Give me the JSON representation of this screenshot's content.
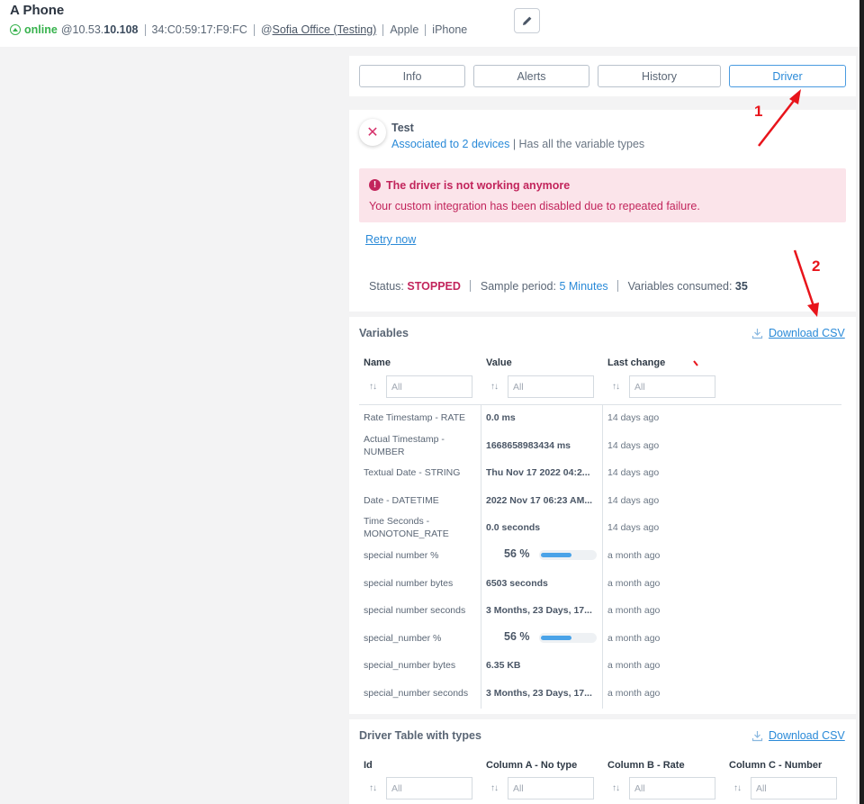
{
  "header": {
    "device_name": "A Phone",
    "status": "online",
    "ip_prefix": "@10.53.",
    "ip_suffix": "10.108",
    "mac": "34:C0:59:17:F9:FC",
    "location_prefix": "@",
    "location": "Sofia Office (Testing)",
    "manufacturer": "Apple",
    "model": "iPhone"
  },
  "tabs": [
    "Info",
    "Alerts",
    "History",
    "Driver"
  ],
  "driver": {
    "name": "Test",
    "associated_link": "Associated to 2 devices",
    "description": "| Has all the variable types",
    "alert_title": "The driver is not working anymore",
    "alert_message": "Your custom integration has been disabled due to repeated failure.",
    "retry_label": "Retry now",
    "status_label": "Status:",
    "status_value": "STOPPED",
    "sample_label": "Sample period:",
    "sample_value": "5 Minutes",
    "consumed_label": "Variables consumed:",
    "consumed_value": "35"
  },
  "variables": {
    "title": "Variables",
    "download_label": "Download CSV",
    "columns": [
      "Name",
      "Value",
      "Last change"
    ],
    "filter_placeholder": "All",
    "rows": [
      {
        "name": "Rate Timestamp - RATE",
        "value": "0.0 ms",
        "last": "14 days ago"
      },
      {
        "name": "Actual Timestamp - NUMBER",
        "value": "1668658983434 ms",
        "last": "14 days ago"
      },
      {
        "name": "Textual Date - STRING",
        "value": "Thu Nov 17 2022 04:2...",
        "last": "14 days ago"
      },
      {
        "name": "Date - DATETIME",
        "value": "2022 Nov 17 06:23 AM...",
        "last": "14 days ago"
      },
      {
        "name": "Time Seconds - MONOTONE_RATE",
        "value": "0.0 seconds",
        "last": "14 days ago"
      },
      {
        "name": "special number %",
        "value": "56 %",
        "progress": 0.56,
        "last": "a month ago"
      },
      {
        "name": "special number bytes",
        "value": "6503 seconds",
        "last": "a month ago"
      },
      {
        "name": "special number seconds",
        "value": "3 Months, 23 Days, 17...",
        "last": "a month ago"
      },
      {
        "name": "special_number %",
        "value": "56 %",
        "progress": 0.56,
        "last": "a month ago"
      },
      {
        "name": "special_number bytes",
        "value": "6.35 KB",
        "last": "a month ago"
      },
      {
        "name": "special_number seconds",
        "value": "3 Months, 23 Days, 17...",
        "last": "a month ago"
      }
    ]
  },
  "driver_table": {
    "title": "Driver Table with types",
    "download_label": "Download CSV",
    "columns": [
      "Id",
      "Column A - No type",
      "Column B - Rate",
      "Column C - Number"
    ],
    "filter_placeholder": "All"
  },
  "annotations": {
    "marker_1": "1",
    "marker_2": "2"
  },
  "colors": {
    "accent": "#2a8ad8",
    "danger": "#c2255c",
    "online": "#37b24d",
    "annotation": "#e8141b"
  }
}
